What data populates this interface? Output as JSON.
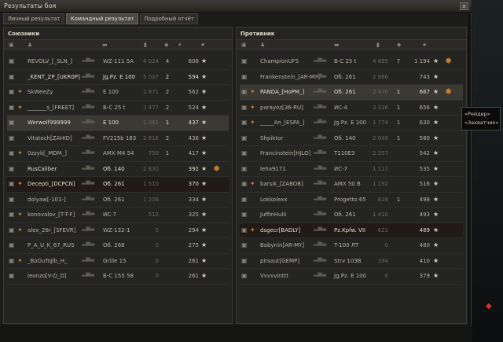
{
  "window": {
    "title": "Результаты боя",
    "close_label": "x"
  },
  "tabs": [
    {
      "label": "Личный результат",
      "active": false
    },
    {
      "label": "Командный результат",
      "active": true
    },
    {
      "label": "Подробный отчёт",
      "active": false
    }
  ],
  "allies": {
    "title": "Союзники",
    "rows": [
      {
        "name": "REVOLV_[_SLN_]",
        "tank": "WZ-111 5A",
        "damage": "4 024",
        "kills": "4",
        "xp": "606",
        "state": "dim",
        "medal": ""
      },
      {
        "name": "_KENT_ZP_[UKR0P]",
        "tank": "Jg.Pz. E 100",
        "damage": "5 007",
        "kills": "2",
        "xp": "594",
        "state": "normal",
        "medal": ""
      },
      {
        "name": "SkWeeZy",
        "tank": "E 100",
        "damage": "2 871",
        "kills": "2",
        "xp": "562",
        "state": "dim",
        "medal": "rank"
      },
      {
        "name": "_______s_[FREET]",
        "tank": "B-C 25 t",
        "damage": "2 477",
        "kills": "2",
        "xp": "524",
        "state": "dim",
        "medal": "rank"
      },
      {
        "name": "Werwolf999999",
        "tank": "E 100",
        "damage": "2 061",
        "kills": "1",
        "xp": "437",
        "state": "hl",
        "medal": ""
      },
      {
        "name": "Vitatech[ZAHID]",
        "tank": "FV215b 183",
        "damage": "2 616",
        "kills": "2",
        "xp": "436",
        "state": "dim",
        "medal": ""
      },
      {
        "name": "0zzyk[_MDM_]",
        "tank": "AMX M4 54",
        "damage": "750",
        "kills": "1",
        "xp": "417",
        "state": "dim",
        "medal": "rank"
      },
      {
        "name": "RusCaliber",
        "tank": "Об. 140",
        "damage": "2 830",
        "kills": "",
        "xp": "392",
        "state": "normal",
        "medal": "",
        "award": true
      },
      {
        "name": "Decepti_[DCPCN]",
        "tank": "Об. 261",
        "damage": "1 510",
        "kills": "",
        "xp": "370",
        "state": "dead",
        "medal": "rank"
      },
      {
        "name": "dolyaw[-101-]",
        "tank": "Об. 261",
        "damage": "1 206",
        "kills": "",
        "xp": "334",
        "state": "dim",
        "medal": ""
      },
      {
        "name": "konovalov_[T-T-F]",
        "tank": "ИС-7",
        "damage": "512",
        "kills": "",
        "xp": "325",
        "state": "dim",
        "medal": "rank"
      },
      {
        "name": "alex_26r_[SFEVR]",
        "tank": "WZ-132-1",
        "damage": "0",
        "kills": "",
        "xp": "294",
        "state": "dim",
        "medal": "rank"
      },
      {
        "name": "P_A_U_K_67_RUS",
        "tank": "Об. 268",
        "damage": "0",
        "kills": "",
        "xp": "275",
        "state": "dim",
        "medal": ""
      },
      {
        "name": "_BoDuToJlb_H_",
        "tank": "Grille 15",
        "damage": "0",
        "kills": "",
        "xp": "261",
        "state": "dim",
        "medal": "rank"
      },
      {
        "name": "leonzo[V-D_D]",
        "tank": "B-C 155 58",
        "damage": "0",
        "kills": "",
        "xp": "261",
        "state": "dim",
        "medal": ""
      }
    ]
  },
  "enemies": {
    "title": "Противник",
    "rows": [
      {
        "name": "ChampionUFS",
        "tank": "B-C 25 t",
        "damage": "4 895",
        "kills": "7",
        "xp": "1 194",
        "state": "dim",
        "medal": "",
        "award": true
      },
      {
        "name": "Frankenstein_[AR-MY]",
        "tank": "Об. 261",
        "damage": "2 866",
        "kills": "",
        "xp": "743",
        "state": "dim",
        "medal": ""
      },
      {
        "name": "PANDA_[HoPM_]",
        "tank": "Об. 261",
        "damage": "2 470",
        "kills": "1",
        "xp": "667",
        "state": "hl",
        "medal": "rank",
        "award": true
      },
      {
        "name": "parayoz[36-RU]",
        "tank": "ИС-4",
        "damage": "3 336",
        "kills": "1",
        "xp": "656",
        "state": "dim",
        "medal": "rank"
      },
      {
        "name": "_____An_[ESPA_]",
        "tank": "Jg.Pz. E 100",
        "damage": "1 774",
        "kills": "1",
        "xp": "630",
        "state": "dim",
        "medal": "rank"
      },
      {
        "name": "Shpiktor",
        "tank": "Об. 140",
        "damage": "2 045",
        "kills": "1",
        "xp": "580",
        "state": "dim",
        "medal": ""
      },
      {
        "name": "Francinstein[HJLO]",
        "tank": "T110E3",
        "damage": "2 257",
        "kills": "",
        "xp": "542",
        "state": "dim",
        "medal": ""
      },
      {
        "name": "leha9171",
        "tank": "ИС-7",
        "damage": "1 111",
        "kills": "",
        "xp": "535",
        "state": "dim",
        "medal": ""
      },
      {
        "name": "barsik_[ZABOB]",
        "tank": "AMX 50 B",
        "damage": "1 192",
        "kills": "",
        "xp": "516",
        "state": "dim",
        "medal": "rank"
      },
      {
        "name": "Lokkolexx",
        "tank": "Progetto 65",
        "damage": "828",
        "kills": "1",
        "xp": "498",
        "state": "dim",
        "medal": ""
      },
      {
        "name": "JuffinHulli",
        "tank": "Об. 261",
        "damage": "1 410",
        "kills": "",
        "xp": "493",
        "state": "dim",
        "medal": ""
      },
      {
        "name": "dsgecr[BADLY]",
        "tank": "Pz.Kpfw. VII",
        "damage": "621",
        "kills": "",
        "xp": "489",
        "state": "dead",
        "medal": "rank"
      },
      {
        "name": "Babynin[AR-MY]",
        "tank": "T-100 ЛТ",
        "damage": "0",
        "kills": "",
        "xp": "480",
        "state": "dim",
        "medal": ""
      },
      {
        "name": "pirsaut[GEMP]",
        "tank": "Strv 103B",
        "damage": "394",
        "kills": "",
        "xp": "410",
        "state": "dim",
        "medal": ""
      },
      {
        "name": "Vvvvvinttt",
        "tank": "Jg.Pz. E 100",
        "damage": "0",
        "kills": "",
        "xp": "379",
        "state": "dim",
        "medal": ""
      }
    ]
  },
  "tooltip": {
    "line1": "«Рейдер»",
    "line2": "«Захватчик»"
  },
  "colors": {
    "accent": "#c77f2f",
    "text": "#b9b3a6",
    "highlight": "#e2dccd"
  }
}
